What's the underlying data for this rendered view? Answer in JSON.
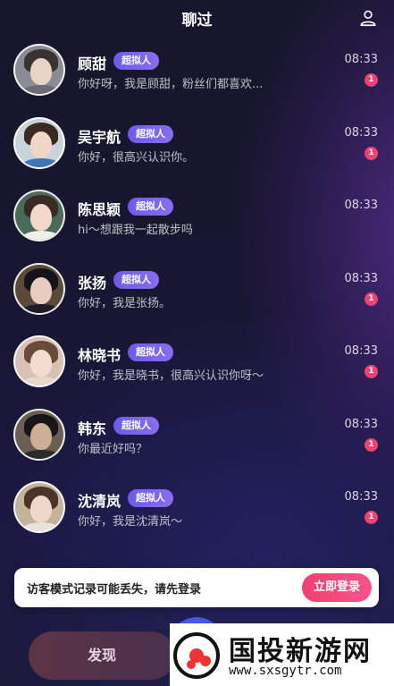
{
  "header": {
    "title": "聊过",
    "user_icon": "user-icon"
  },
  "badge_label": "超拟人",
  "conversations": [
    {
      "name": "顾甜",
      "message": "你好呀，我是顾甜，粉丝们都喜欢...",
      "time": "08:33",
      "unread": "1",
      "avatar": {
        "hair": "#3a3330",
        "face": "#e9d2c6",
        "body": "#6c6c74",
        "bg": "#8b8b96"
      }
    },
    {
      "name": "吴宇航",
      "message": "你好，很高兴认识你。",
      "time": "08:33",
      "unread": "1",
      "avatar": {
        "hair": "#3a2a22",
        "face": "#efd6c6",
        "body": "#3f74b6",
        "bg": "#c9d3dc"
      }
    },
    {
      "name": "陈思颖",
      "message": "hi～想跟我一起散步吗",
      "time": "08:33",
      "unread": "",
      "avatar": {
        "hair": "#3b2a24",
        "face": "#f1d8cb",
        "body": "#f2eee8",
        "bg": "#4a6a5a"
      }
    },
    {
      "name": "张扬",
      "message": "你好，我是张扬。",
      "time": "08:33",
      "unread": "1",
      "avatar": {
        "hair": "#15121a",
        "face": "#e8cdbf",
        "body": "#1d1c26",
        "bg": "#5a4a3a"
      }
    },
    {
      "name": "林晓书",
      "message": "你好，我是晓书，很高兴认识你呀～",
      "time": "08:33",
      "unread": "1",
      "avatar": {
        "hair": "#6a4a3a",
        "face": "#f3dcd2",
        "body": "#e8d8cc",
        "bg": "#d7c1b4"
      }
    },
    {
      "name": "韩东",
      "message": "你最近好吗？",
      "time": "08:33",
      "unread": "1",
      "avatar": {
        "hair": "#18151a",
        "face": "#cfae98",
        "body": "#2a2a2e",
        "bg": "#6a5e52"
      }
    },
    {
      "name": "沈清岚",
      "message": "你好，我是沈清岚～",
      "time": "08:33",
      "unread": "1",
      "avatar": {
        "hair": "#4a3528",
        "face": "#efd8cb",
        "body": "#e9e3dc",
        "bg": "#c2b49b"
      }
    }
  ],
  "toast": {
    "text": "访客模式记录可能丢失，请先登录",
    "button_label": "立即登录"
  },
  "bottom_nav": {
    "discover_label": "发现"
  },
  "watermark": {
    "title": "国投新游网",
    "url": "www.sxsgytr.com"
  },
  "colors": {
    "accent_pink": "#f0416e",
    "badge_purple": "#7a62ee",
    "unread_red": "#ef4270"
  }
}
